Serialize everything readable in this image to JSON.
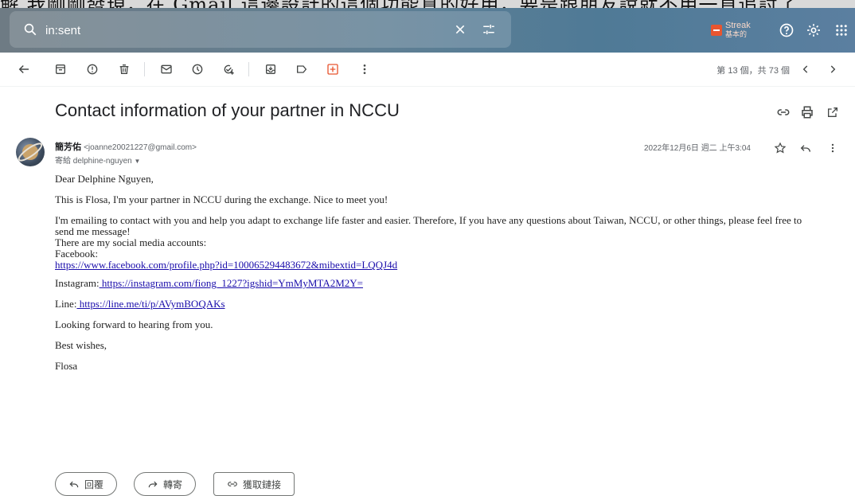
{
  "top_strip_text": "解 我剛剛發現，在 Gmail 這邊設計的這個功能真的好用，要是跟朋友說就不用一直追討了...",
  "search": {
    "value": "in:sent",
    "placeholder": ""
  },
  "streak": {
    "name": "Streak",
    "sub": "基本的"
  },
  "toolbar": {
    "count": "第 13 個，共 73 個"
  },
  "email": {
    "subject": "Contact information of your partner in NCCU",
    "sender_name": "簡芳佑",
    "sender_email": "<joanne20021227@gmail.com>",
    "to": "寄給 delphine-nguyen",
    "date": "2022年12月6日 週二 上午3:04",
    "greeting": "Dear Delphine Nguyen,",
    "p1": "This is Flosa, I'm your partner in NCCU during the exchange. Nice to meet you!",
    "p2": "I'm emailing to contact with you and help you adapt to exchange life faster and easier. Therefore, If you have any questions about Taiwan, NCCU, or other things, please feel free to send me message!",
    "p3": "There are my social media accounts:",
    "facebook_label": "Facebook:",
    "facebook_url": "https://www.facebook.com/profile.php?id=100065294483672&mibextid=LQQJ4d",
    "instagram_label": "Instagram:",
    "instagram_url": " https://instagram.com/fiong_1227?igshid=YmMyMTA2M2Y=",
    "line_label": "Line:",
    "line_url": " https://line.me/ti/p/AVymBOQAKs",
    "p4": "Looking forward to hearing from you.",
    "p5": "Best wishes,",
    "sign": "Flosa"
  },
  "actions": {
    "reply": "回覆",
    "forward": "轉寄",
    "getlink": "獲取鏈接"
  }
}
